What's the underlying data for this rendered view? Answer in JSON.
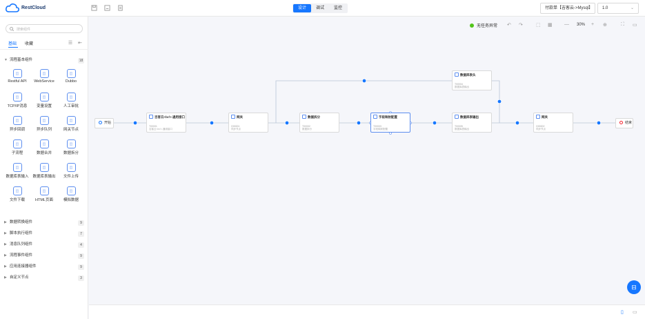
{
  "app": {
    "brand": "RestCloud"
  },
  "topbar": {
    "modes": [
      "设计",
      "调试",
      "监控"
    ],
    "active_mode": "设计",
    "flow_select": "付款单【吉客云->Mysql】",
    "version_select": "1.0"
  },
  "sidebar": {
    "search_placeholder": "搜索组件",
    "tabs": [
      "基础",
      "收藏"
    ],
    "active_tab": "基础",
    "expanded_group": {
      "label": "流程基本组件",
      "count": "18"
    },
    "components": [
      {
        "label": "Restful API",
        "icon": "api-icon"
      },
      {
        "label": "WebService",
        "icon": "webservice-icon"
      },
      {
        "label": "Dubbo",
        "icon": "dubbo-icon"
      },
      {
        "label": "TCP/IP消息",
        "icon": "tcp-icon"
      },
      {
        "label": "变量设置",
        "icon": "variable-icon"
      },
      {
        "label": "人工审批",
        "icon": "approval-icon"
      },
      {
        "label": "异步回调",
        "icon": "callback-icon"
      },
      {
        "label": "异步队列",
        "icon": "queue-icon"
      },
      {
        "label": "网关节点",
        "icon": "gateway-icon"
      },
      {
        "label": "子流程",
        "icon": "subflow-icon"
      },
      {
        "label": "数据合并",
        "icon": "merge-icon"
      },
      {
        "label": "数据拆分",
        "icon": "split-icon"
      },
      {
        "label": "数据库表输入",
        "icon": "db-input-icon"
      },
      {
        "label": "数据库表输出",
        "icon": "db-output-icon"
      },
      {
        "label": "文件上传",
        "icon": "upload-icon"
      },
      {
        "label": "文件下载",
        "icon": "download-icon"
      },
      {
        "label": "HTML页面",
        "icon": "html-icon"
      },
      {
        "label": "模拟数据",
        "icon": "mock-icon"
      }
    ],
    "groups": [
      {
        "label": "数据转换组件",
        "count": "9"
      },
      {
        "label": "脚本执行组件",
        "count": "7"
      },
      {
        "label": "消息队列组件",
        "count": "4"
      },
      {
        "label": "流程事件组件",
        "count": "9"
      },
      {
        "label": "应用连接器组件",
        "count": "9"
      },
      {
        "label": "自定义节点",
        "count": "3"
      }
    ]
  },
  "canvas": {
    "status": "无任务异常",
    "zoom": "30%",
    "start_label": "开始",
    "end_label": "结束",
    "nodes": [
      {
        "title": "吉客云<br/>-通用接口",
        "id": "T00001",
        "desc": "吉客云<br/>-通用接口"
      },
      {
        "title": "网关",
        "id": "G00001",
        "desc": "同步节点"
      },
      {
        "title": "数据拆分",
        "id": "T00002",
        "desc": "数据拆分"
      },
      {
        "title": "字段映射配置",
        "id": "T00003",
        "desc": "字段映射配置"
      },
      {
        "title": "数据库表头",
        "id": "T00004",
        "desc": "数据库表输出"
      },
      {
        "title": "数据库表输出",
        "id": "T00005",
        "desc": "数据库表输出"
      },
      {
        "title": "网关",
        "id": "G00002",
        "desc": "同步节点"
      }
    ]
  },
  "colors": {
    "accent": "#1677ff",
    "success": "#52c41a"
  }
}
